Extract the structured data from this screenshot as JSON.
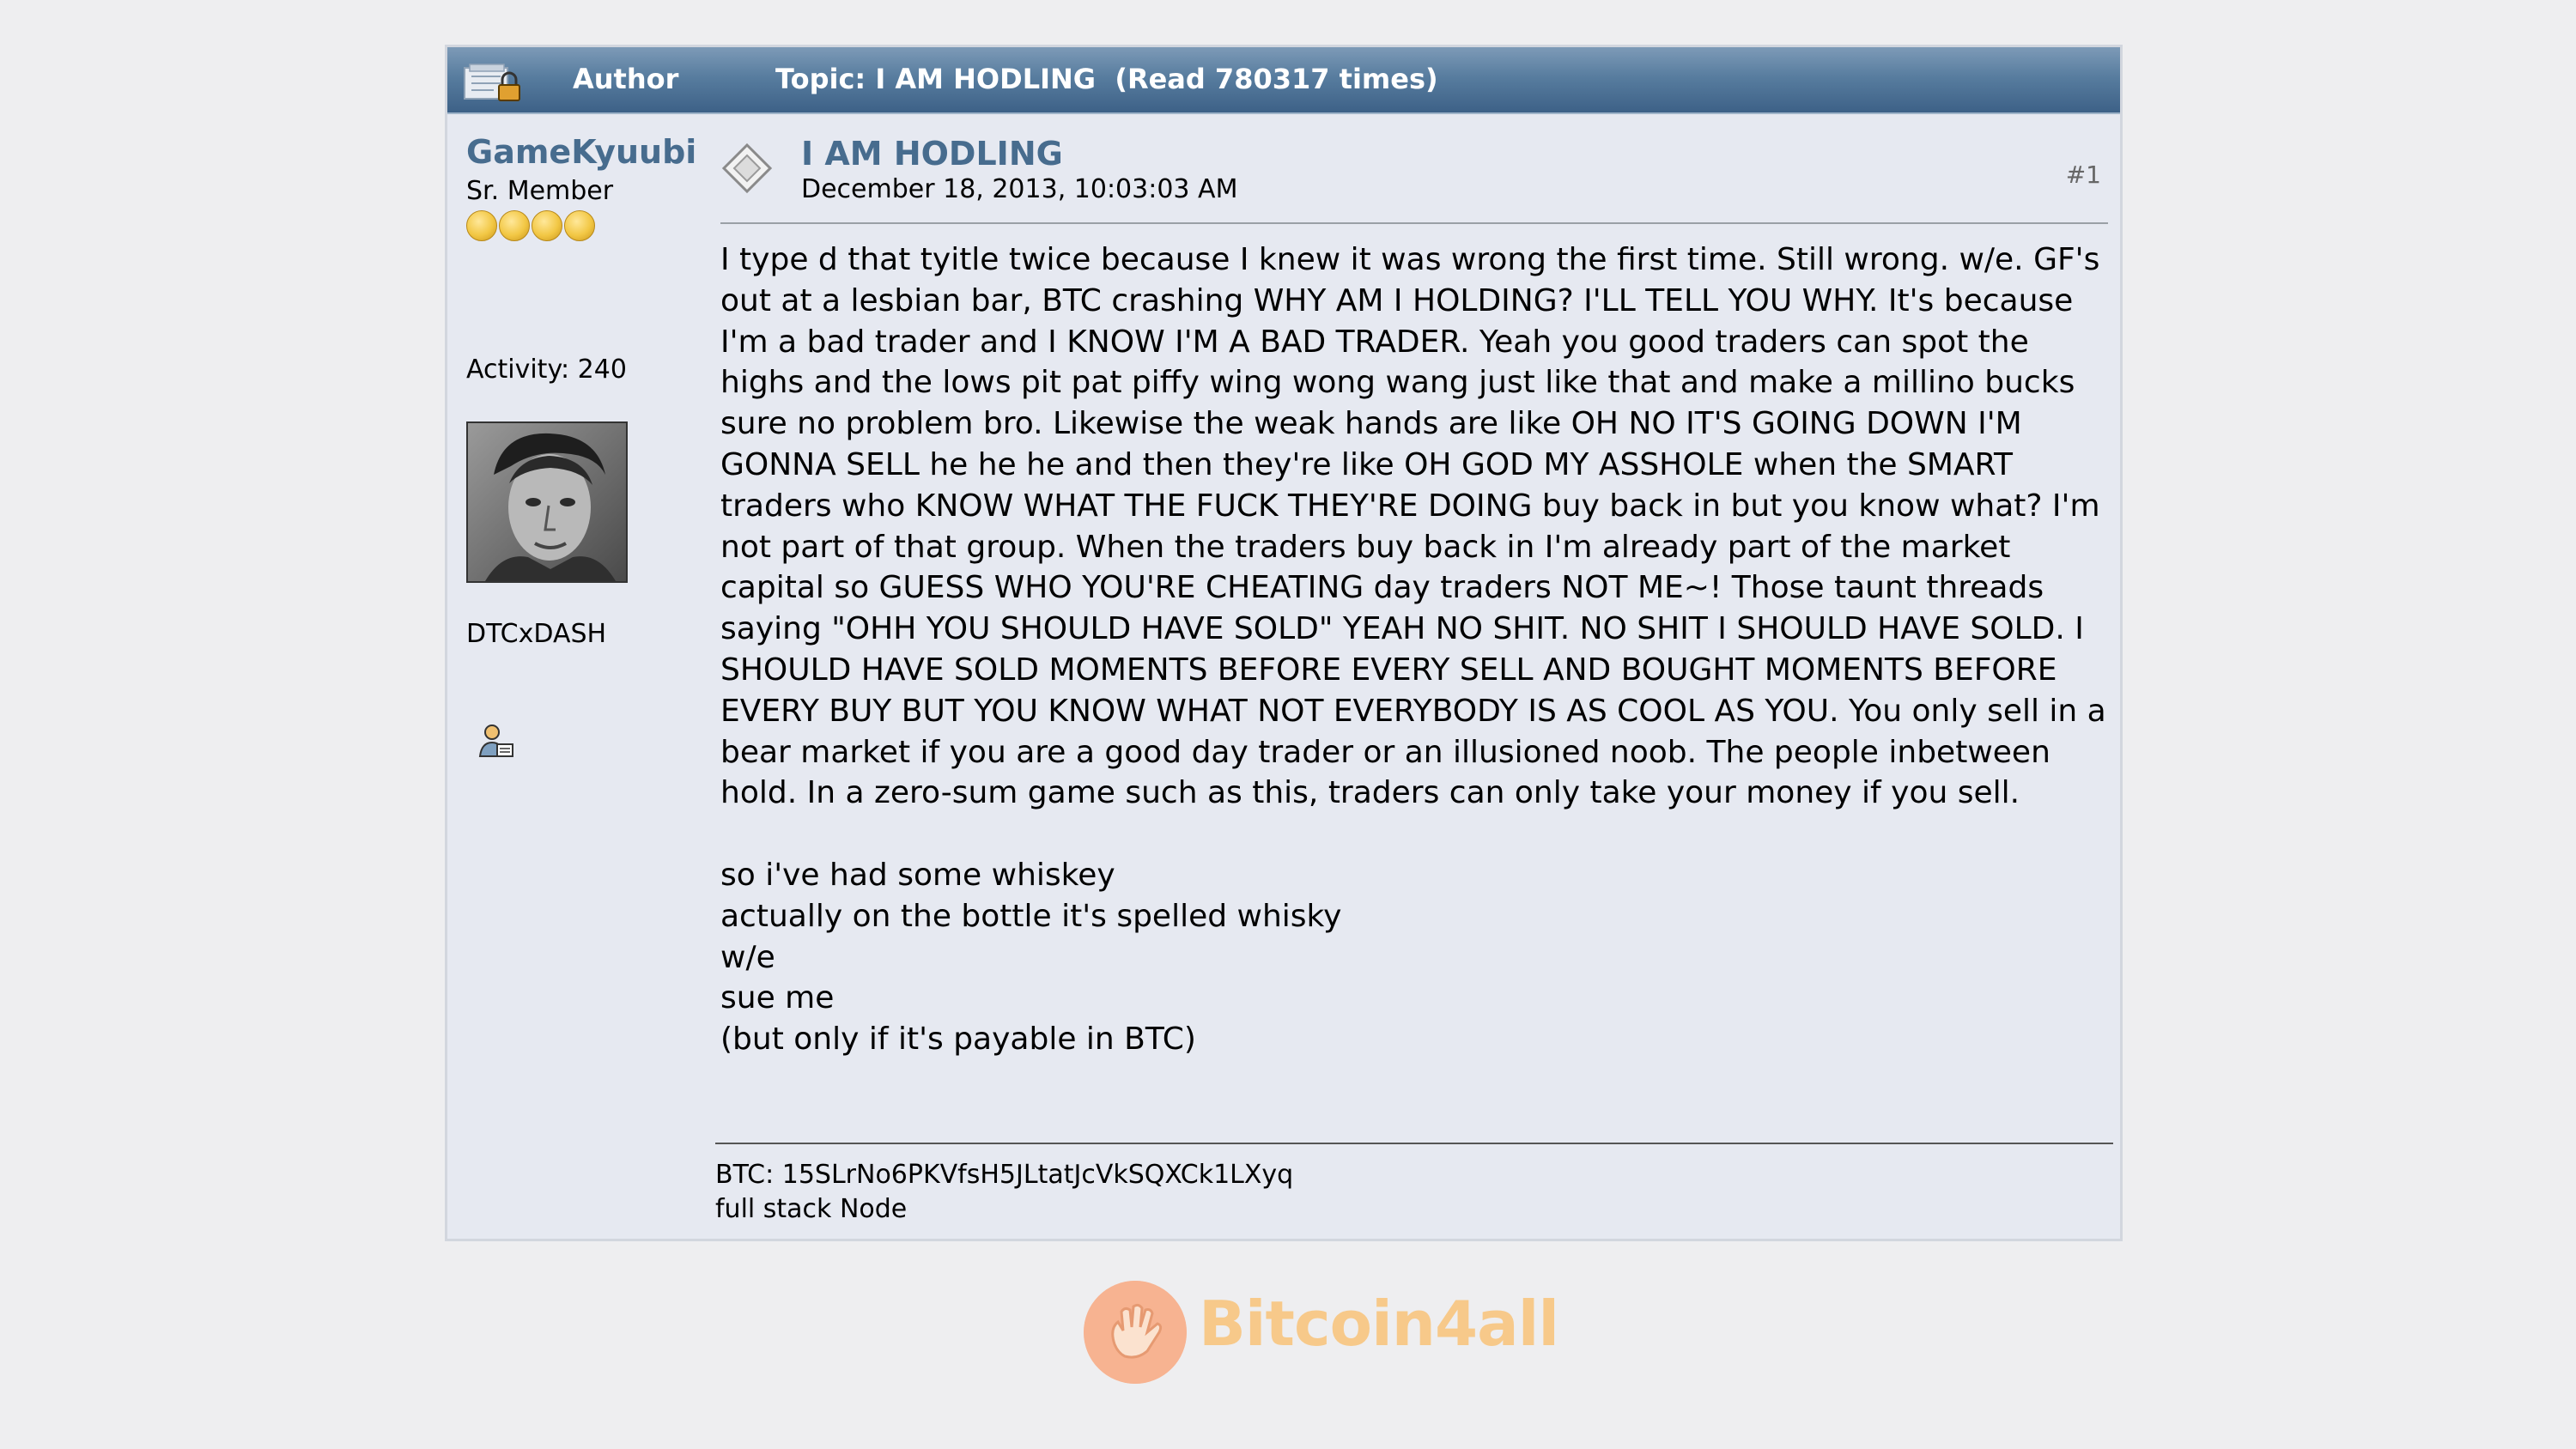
{
  "header": {
    "author_label": "Author",
    "topic_label": "Topic: I AM HODLING  (Read 780317 times)"
  },
  "poster": {
    "name": "GameKyuubi",
    "rank": "Sr. Member",
    "stars": 4,
    "activity": "Activity: 240",
    "personal_text": "DTCxDASH"
  },
  "post": {
    "title": "I AM HODLING",
    "date": "December 18, 2013, 10:03:03 AM",
    "number": "#1",
    "body": [
      "I type d that tyitle twice because I knew it was wrong the first time.  Still wrong.  w/e.  GF's out at a lesbian bar, BTC crashing WHY AM I HOLDING? I'LL TELL YOU WHY.  It's because I'm a bad trader and I KNOW I'M A BAD TRADER.  Yeah you good traders can spot the highs and the lows pit pat piffy wing wong wang just like that and make a millino bucks sure no problem bro.  Likewise the weak hands are like OH NO IT'S GOING DOWN I'M GONNA SELL he he he and then they're like OH GOD MY ASSHOLE when the SMART traders who KNOW WHAT THE FUCK THEY'RE DOING buy back in but you know what?  I'm not part of that group.  When the traders buy back in I'm already part of the market capital so GUESS WHO YOU'RE CHEATING day traders NOT ME~!  Those taunt threads saying \"OHH YOU SHOULD HAVE SOLD\" YEAH NO SHIT.  NO SHIT I SHOULD HAVE SOLD.  I SHOULD HAVE SOLD MOMENTS BEFORE EVERY SELL AND BOUGHT MOMENTS BEFORE EVERY BUY BUT YOU KNOW WHAT NOT EVERYBODY IS AS COOL AS YOU.  You only sell in a bear market if you are a good day trader or an illusioned noob.  The people inbetween hold.  In a zero-sum game such as this, traders can only take your money if you sell."
    ],
    "lines": [
      "so i've had some whiskey",
      "actually on the bottle it's spelled whisky",
      "w/e",
      "sue me",
      "(but only if it's payable in BTC)"
    ]
  },
  "signature": {
    "line1": "BTC: 15SLrNo6PKVfsH5JLtatJcVkSQXCk1LXyq",
    "line2": "full stack Node"
  },
  "watermark": {
    "text": "Bitcoin4all"
  },
  "icons": {
    "header": "topic-locked-icon",
    "post": "post-diamond-icon",
    "profile": "user-profile-icon"
  },
  "colors": {
    "header_bg": "#4f7396",
    "link": "#476c8e",
    "panel_bg": "#e6e9f1",
    "brand": "#f7b391"
  }
}
